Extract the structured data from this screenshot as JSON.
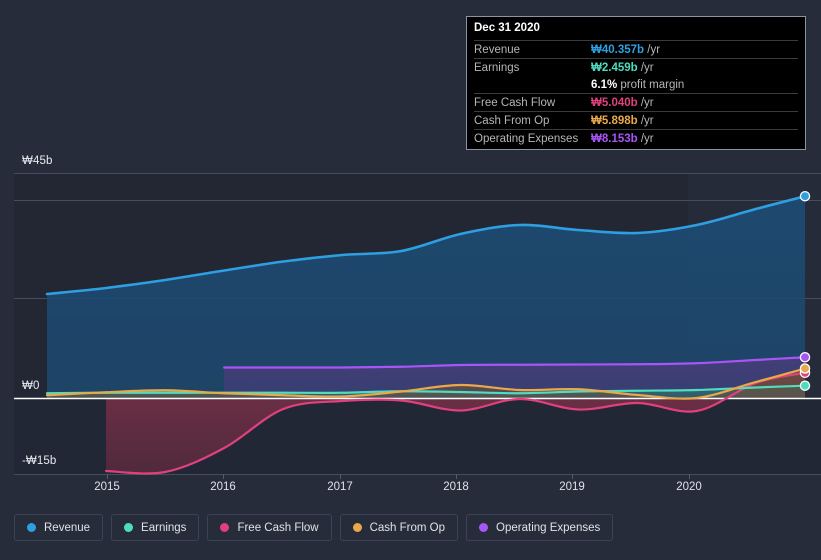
{
  "chart_data": {
    "type": "area",
    "title": "",
    "xlabel": "",
    "ylabel": "",
    "currency": "₩",
    "grid": true,
    "legend_position": "bottom",
    "ylim": [
      -15,
      45
    ],
    "y_ticks": [
      {
        "label": "₩45b",
        "value": 45
      },
      {
        "label": "₩0",
        "value": 0
      },
      {
        "label": "-₩15b",
        "value": -15
      }
    ],
    "x_ticks": [
      "2015",
      "2016",
      "2017",
      "2018",
      "2019",
      "2020"
    ],
    "x_range": [
      "2014-07",
      "2020-12"
    ],
    "series": [
      {
        "name": "Revenue",
        "color": "#2e9fe0",
        "fill": "#1d4a72",
        "x": [
          "2014-07",
          "2015-01",
          "2015-07",
          "2016-01",
          "2016-07",
          "2017-01",
          "2017-07",
          "2018-01",
          "2018-07",
          "2019-01",
          "2019-07",
          "2020-01",
          "2020-07",
          "2020-12"
        ],
        "values": [
          20.8,
          22.0,
          23.6,
          25.5,
          27.3,
          28.6,
          29.4,
          32.8,
          34.6,
          33.6,
          33.0,
          34.6,
          37.8,
          40.357
        ]
      },
      {
        "name": "Earnings",
        "color": "#4fdcc0",
        "fill": "#2d6f6c",
        "x": [
          "2014-07",
          "2015-01",
          "2015-07",
          "2016-01",
          "2016-07",
          "2017-01",
          "2017-07",
          "2018-01",
          "2018-07",
          "2019-01",
          "2019-07",
          "2020-01",
          "2020-07",
          "2020-12"
        ],
        "values": [
          0.95,
          1.05,
          1.05,
          1.05,
          1.05,
          1.05,
          1.35,
          1.2,
          0.95,
          1.3,
          1.45,
          1.6,
          2.1,
          2.459
        ]
      },
      {
        "name": "Free Cash Flow",
        "color": "#e0417e",
        "fill": "#6e3246",
        "x": [
          "2015-01",
          "2015-07",
          "2016-01",
          "2016-07",
          "2017-01",
          "2017-07",
          "2018-01",
          "2018-07",
          "2019-01",
          "2019-07",
          "2020-01",
          "2020-07",
          "2020-12"
        ],
        "values": [
          -14.6,
          -14.8,
          -10.0,
          -2.2,
          -0.6,
          -0.5,
          -2.5,
          -0.2,
          -2.3,
          -1.0,
          -2.6,
          3.0,
          5.04
        ]
      },
      {
        "name": "Cash From Op",
        "color": "#e9a94b",
        "fill": "#6a4f3c",
        "x": [
          "2014-07",
          "2015-01",
          "2015-07",
          "2016-01",
          "2016-07",
          "2017-01",
          "2017-07",
          "2018-01",
          "2018-07",
          "2019-01",
          "2019-07",
          "2020-01",
          "2020-07",
          "2020-12"
        ],
        "values": [
          0.55,
          1.15,
          1.55,
          0.95,
          0.55,
          0.3,
          1.3,
          2.6,
          1.6,
          1.75,
          0.6,
          0.0,
          3.2,
          5.898
        ]
      },
      {
        "name": "Operating Expenses",
        "color": "#a855f7",
        "fill": "#4a3c7a",
        "x": [
          "2016-01",
          "2016-07",
          "2017-01",
          "2017-07",
          "2018-01",
          "2018-07",
          "2019-01",
          "2019-07",
          "2020-01",
          "2020-07",
          "2020-12"
        ],
        "values": [
          6.1,
          6.1,
          6.1,
          6.25,
          6.6,
          6.65,
          6.7,
          6.75,
          6.95,
          7.6,
          8.153
        ]
      }
    ]
  },
  "tooltip": {
    "title": "Dec 31 2020",
    "rows": [
      {
        "label": "Revenue",
        "value": "₩40.357b",
        "unit": "/yr",
        "color": "#2e9fe0"
      },
      {
        "label": "Earnings",
        "value": "₩2.459b",
        "unit": "/yr",
        "color": "#4fdcc0"
      },
      {
        "label": "Free Cash Flow",
        "value": "₩5.040b",
        "unit": "/yr",
        "color": "#e0417e"
      },
      {
        "label": "Cash From Op",
        "value": "₩5.898b",
        "unit": "/yr",
        "color": "#e9a94b"
      },
      {
        "label": "Operating Expenses",
        "value": "₩8.153b",
        "unit": "/yr",
        "color": "#a855f7"
      }
    ],
    "profit_margin_value": "6.1%",
    "profit_margin_label": "profit margin"
  },
  "legend": {
    "items": [
      {
        "label": "Revenue",
        "color": "#2e9fe0"
      },
      {
        "label": "Earnings",
        "color": "#4fdcc0"
      },
      {
        "label": "Free Cash Flow",
        "color": "#e0417e"
      },
      {
        "label": "Cash From Op",
        "color": "#e9a94b"
      },
      {
        "label": "Operating Expenses",
        "color": "#a855f7"
      }
    ]
  },
  "axis": {
    "y_labels": [
      "₩45b",
      "₩0",
      "-₩15b"
    ],
    "x_labels": [
      "2015",
      "2016",
      "2017",
      "2018",
      "2019",
      "2020"
    ]
  }
}
